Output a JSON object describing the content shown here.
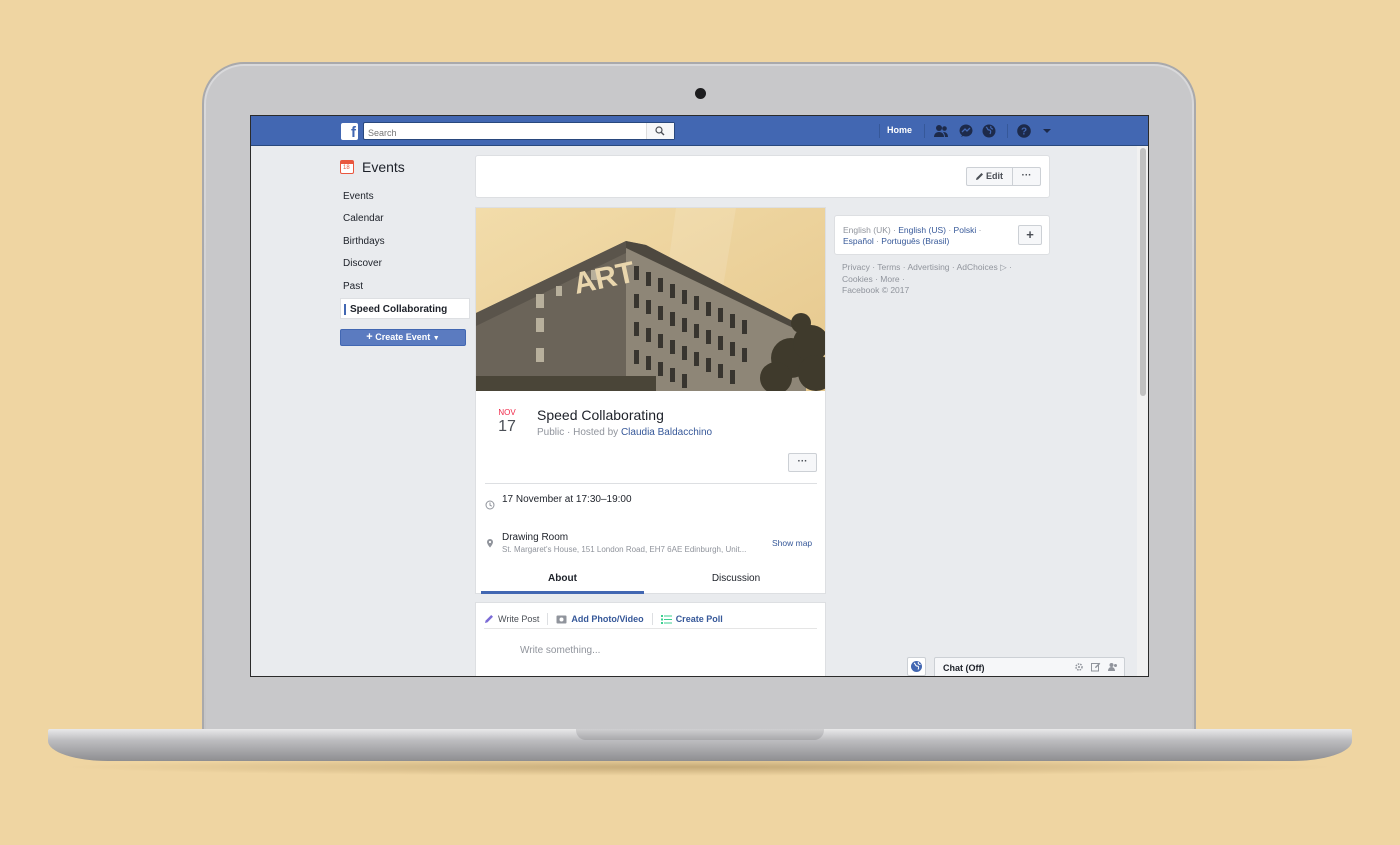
{
  "topbar": {
    "search_placeholder": "Search",
    "home_label": "Home"
  },
  "sidebar": {
    "title": "Events",
    "calendar_icon_day": "18",
    "items": [
      {
        "label": "Events"
      },
      {
        "label": "Calendar"
      },
      {
        "label": "Birthdays"
      },
      {
        "label": "Discover"
      },
      {
        "label": "Past"
      },
      {
        "label": "Speed Collaborating",
        "active": true
      }
    ],
    "create_label": "Create Event"
  },
  "edit_bar": {
    "edit_label": "Edit",
    "more_label": "···"
  },
  "event": {
    "cover_text": "ART",
    "month": "NOV",
    "day": "17",
    "title": "Speed Collaborating",
    "visibility": "Public · Hosted by ",
    "host": "Claudia Baldacchino",
    "more_label": "···",
    "time": "17 November at 17:30–19:00",
    "place": "Drawing Room",
    "address": "St. Margaret's House, 151 London Road, EH7 6AE Edinburgh, Unit...",
    "show_map": "Show map",
    "tabs": [
      {
        "label": "About",
        "active": true
      },
      {
        "label": "Discussion"
      }
    ]
  },
  "composer": {
    "write_post": "Write Post",
    "add_photo": "Add Photo/Video",
    "create_poll": "Create Poll",
    "placeholder": "Write something..."
  },
  "languages": {
    "line1_a": "English (UK) · ",
    "line1_b": "English (US)",
    "line1_c": " · ",
    "line1_d": "Polski",
    "line1_e": " ·",
    "line2_a": "Español",
    "line2_b": " · ",
    "line2_c": "Português (Brasil)",
    "add_label": "+"
  },
  "footer": {
    "line1": "Privacy · Terms · Advertising · AdChoices ▷ ·",
    "line2": "Cookies · More ·",
    "line3": "Facebook © 2017"
  },
  "chat": {
    "label": "Chat (Off)"
  },
  "colors": {
    "background": "#efd5a2",
    "brand_blue": "#4267b2",
    "link_blue": "#365899",
    "month_red": "#f02849"
  }
}
